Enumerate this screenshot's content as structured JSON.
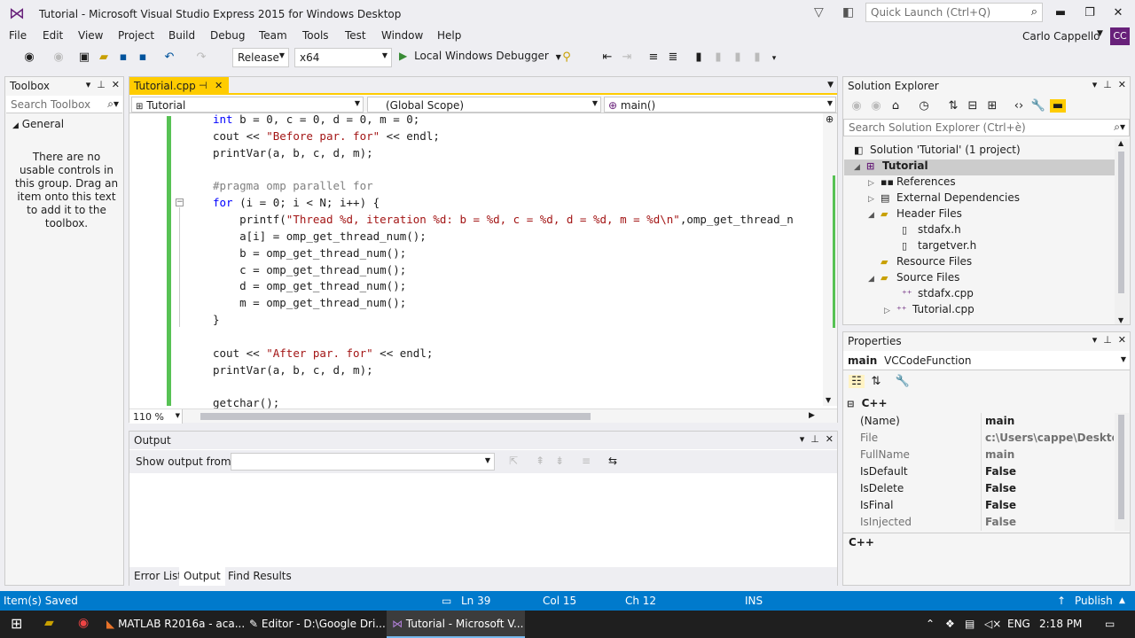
{
  "window": {
    "title": "Tutorial - Microsoft Visual Studio Express 2015 for Windows Desktop",
    "quick_launch_placeholder": "Quick Launch (Ctrl+Q)",
    "minimize": "▬",
    "maximize": "❐",
    "close": "✕"
  },
  "menu": {
    "items": [
      "File",
      "Edit",
      "View",
      "Project",
      "Build",
      "Debug",
      "Team",
      "Tools",
      "Test",
      "Window",
      "Help"
    ],
    "user": "Carlo Cappello",
    "avatar_initials": "CC"
  },
  "toolbar": {
    "configuration": "Release",
    "platform": "x64",
    "debugger_label": "Local Windows Debugger"
  },
  "toolbox": {
    "title": "Toolbox",
    "search_placeholder": "Search Toolbox",
    "group": "General",
    "empty_message": "There are no usable controls in this group. Drag an item onto this text to add it to the toolbox."
  },
  "editor": {
    "tab": "Tutorial.cpp",
    "project_scope": "Tutorial",
    "scope": "(Global Scope)",
    "member": "main()",
    "zoom": "110 %",
    "code_lines": [
      "int b = 0, c = 0, d = 0, m = 0;",
      "cout << \"Before par. for\" << endl;",
      "printVar(a, b, c, d, m);",
      "",
      "#pragma omp parallel for",
      "for (i = 0; i < N; i++) {",
      "    printf(\"Thread %d, iteration %d: b = %d, c = %d, d = %d, m = %d\\n\",omp_get_thread_n",
      "    a[i] = omp_get_thread_num();",
      "    b = omp_get_thread_num();",
      "    c = omp_get_thread_num();",
      "    d = omp_get_thread_num();",
      "    m = omp_get_thread_num();",
      "}",
      "",
      "cout << \"After par. for\" << endl;",
      "printVar(a, b, c, d, m);",
      "",
      "getchar();"
    ]
  },
  "output": {
    "title": "Output",
    "show_from_label": "Show output from:",
    "source_value": "",
    "tabs": [
      "Error List",
      "Output",
      "Find Results"
    ],
    "selected_tab": "Output"
  },
  "solution_explorer": {
    "title": "Solution Explorer",
    "search_placeholder": "Search Solution Explorer (Ctrl+è)",
    "items": [
      {
        "label": "Solution 'Tutorial' (1 project)",
        "level": 0,
        "expander": "",
        "icon": "solution-icon"
      },
      {
        "label": "Tutorial",
        "level": 1,
        "expander": "◢",
        "icon": "project-icon"
      },
      {
        "label": "References",
        "level": 2,
        "expander": "▷",
        "icon": "references-icon"
      },
      {
        "label": "External Dependencies",
        "level": 2,
        "expander": "▷",
        "icon": "dependencies-icon"
      },
      {
        "label": "Header Files",
        "level": 2,
        "expander": "◢",
        "icon": "folder-icon"
      },
      {
        "label": "stdafx.h",
        "level": 3,
        "expander": "",
        "icon": "header-file-icon"
      },
      {
        "label": "targetver.h",
        "level": 3,
        "expander": "",
        "icon": "header-file-icon"
      },
      {
        "label": "Resource Files",
        "level": 2,
        "expander": "",
        "icon": "folder-icon"
      },
      {
        "label": "Source Files",
        "level": 2,
        "expander": "◢",
        "icon": "folder-icon"
      },
      {
        "label": "stdafx.cpp",
        "level": 3,
        "expander": "",
        "icon": "cpp-file-icon"
      },
      {
        "label": "Tutorial.cpp",
        "level": 3,
        "expander": "▷",
        "icon": "cpp-file-icon"
      }
    ]
  },
  "properties": {
    "title": "Properties",
    "object_name": "main",
    "object_type": "VCCodeFunction",
    "category": "C++",
    "rows": [
      {
        "name": "(Name)",
        "value": "main",
        "dim": false
      },
      {
        "name": "File",
        "value": "c:\\Users\\cappe\\Desktop\\\\",
        "dim": true
      },
      {
        "name": "FullName",
        "value": "main",
        "dim": true
      },
      {
        "name": "IsDefault",
        "value": "False",
        "dim": false
      },
      {
        "name": "IsDelete",
        "value": "False",
        "dim": false
      },
      {
        "name": "IsFinal",
        "value": "False",
        "dim": false
      },
      {
        "name": "IsInjected",
        "value": "False",
        "dim": true
      }
    ],
    "description": "C++"
  },
  "status": {
    "message": "Item(s) Saved",
    "line": "Ln 39",
    "col": "Col 15",
    "ch": "Ch 12",
    "mode": "INS",
    "publish": "Publish"
  },
  "taskbar": {
    "tasks": [
      "MATLAB R2016a - aca...",
      "Editor - D:\\Google Dri...",
      "Tutorial - Microsoft V..."
    ],
    "language": "ENG",
    "time": "2:18 PM"
  }
}
